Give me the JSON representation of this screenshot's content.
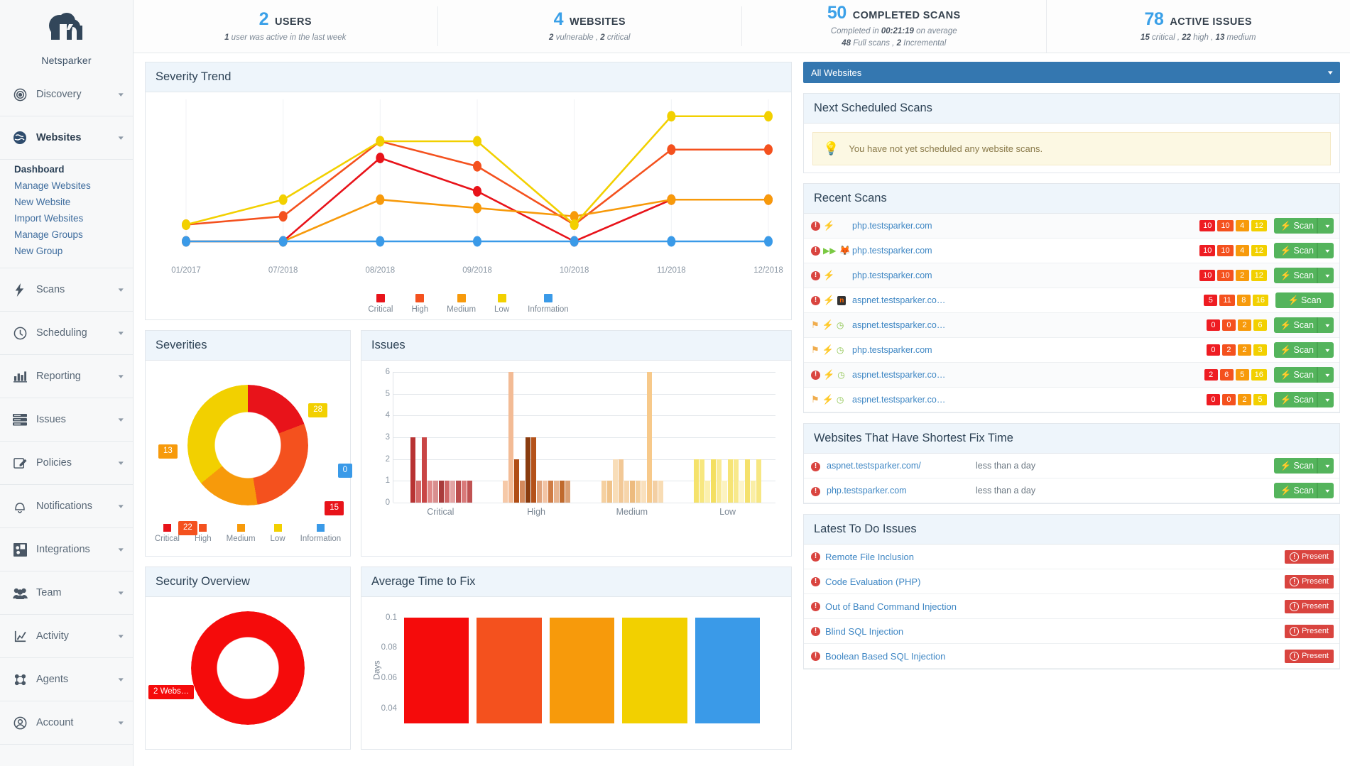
{
  "brand": {
    "name": "Netsparker"
  },
  "sidebar": {
    "items": [
      {
        "label": "Discovery",
        "icon": "target-icon",
        "active": false
      },
      {
        "label": "Websites",
        "icon": "globe-icon",
        "active": true
      },
      {
        "label": "Scans",
        "icon": "bolt-icon",
        "active": false
      },
      {
        "label": "Scheduling",
        "icon": "clock-icon",
        "active": false
      },
      {
        "label": "Reporting",
        "icon": "bar-chart-icon",
        "active": false
      },
      {
        "label": "Issues",
        "icon": "list-icon",
        "active": false
      },
      {
        "label": "Policies",
        "icon": "pencil-note-icon",
        "active": false
      },
      {
        "label": "Notifications",
        "icon": "bell-icon",
        "active": false
      },
      {
        "label": "Integrations",
        "icon": "puzzle-icon",
        "active": false
      },
      {
        "label": "Team",
        "icon": "people-icon",
        "active": false
      },
      {
        "label": "Activity",
        "icon": "activity-icon",
        "active": false
      },
      {
        "label": "Agents",
        "icon": "agents-icon",
        "active": false
      },
      {
        "label": "Account",
        "icon": "account-icon",
        "active": false
      }
    ],
    "websites_subnav": [
      {
        "label": "Dashboard",
        "current": true
      },
      {
        "label": "Manage Websites",
        "current": false
      },
      {
        "label": "New Website",
        "current": false
      },
      {
        "label": "Import Websites",
        "current": false
      },
      {
        "label": "Manage Groups",
        "current": false
      },
      {
        "label": "New Group",
        "current": false
      }
    ]
  },
  "stats": [
    {
      "num": "2",
      "cap": "USERS",
      "sub1_pre": "1",
      "sub1_post": " user was active in the last week",
      "sub2": ""
    },
    {
      "num": "4",
      "cap": "WEBSITES",
      "sub1_pre": "2",
      "sub1_post": " vulnerable , ",
      "sub1_b2": "2",
      "sub1_post2": " critical",
      "sub2": ""
    },
    {
      "num": "50",
      "cap": "COMPLETED SCANS",
      "sub1_pre": "Completed in ",
      "sub1_b": "00:21:19",
      "sub1_post": " on average",
      "sub2_b": "48",
      "sub2_mid": " Full scans , ",
      "sub2_b2": "2",
      "sub2_post": " Incremental"
    },
    {
      "num": "78",
      "cap": "ACTIVE ISSUES",
      "sub1_b": "15",
      "sub1_mid": " critical , ",
      "sub1_b2": "22",
      "sub1_mid2": " high , ",
      "sub1_b3": "13",
      "sub1_post": " medium"
    }
  ],
  "panels": {
    "severity_trend": "Severity Trend",
    "severities": "Severities",
    "issues": "Issues",
    "security_overview": "Security Overview",
    "average_time_to_fix": "Average Time to Fix"
  },
  "right": {
    "website_select": "All Websites",
    "next_scheduled_title": "Next Scheduled Scans",
    "next_scheduled_note": "You have not yet scheduled any website scans.",
    "recent_scans_title": "Recent Scans",
    "shortest_fix_title": "Websites That Have Shortest Fix Time",
    "todo_title": "Latest To Do Issues",
    "scan_label": "Scan",
    "present_label": "Present",
    "recent_scans": [
      {
        "icons": [
          "error",
          "bolt"
        ],
        "host": "php.testsparker.com",
        "badges": [
          "10",
          "10",
          "4",
          "12"
        ],
        "dropdown": true
      },
      {
        "icons": [
          "error",
          "forward",
          "fox"
        ],
        "host": "php.testsparker.com",
        "badges": [
          "10",
          "10",
          "4",
          "12"
        ],
        "dropdown": true
      },
      {
        "icons": [
          "error",
          "bolt"
        ],
        "host": "php.testsparker.com",
        "badges": [
          "10",
          "10",
          "2",
          "12"
        ],
        "dropdown": true
      },
      {
        "icons": [
          "error",
          "bolt",
          "n"
        ],
        "host": "aspnet.testsparker.co…",
        "badges": [
          "5",
          "11",
          "8",
          "16"
        ],
        "dropdown": false
      },
      {
        "icons": [
          "flag",
          "bolt",
          "clock"
        ],
        "host": "aspnet.testsparker.co…",
        "badges": [
          "0",
          "0",
          "2",
          "6"
        ],
        "dropdown": true
      },
      {
        "icons": [
          "flag",
          "bolt",
          "clock"
        ],
        "host": "php.testsparker.com",
        "badges": [
          "0",
          "2",
          "2",
          "3"
        ],
        "dropdown": true
      },
      {
        "icons": [
          "error",
          "bolt",
          "clock"
        ],
        "host": "aspnet.testsparker.co…",
        "badges": [
          "2",
          "6",
          "5",
          "16"
        ],
        "dropdown": true
      },
      {
        "icons": [
          "flag",
          "bolt",
          "clock"
        ],
        "host": "aspnet.testsparker.co…",
        "badges": [
          "0",
          "0",
          "2",
          "5"
        ],
        "dropdown": true
      }
    ],
    "shortest_fix": [
      {
        "host": "aspnet.testsparker.com/",
        "time": "less than a day"
      },
      {
        "host": "php.testsparker.com",
        "time": "less than a day"
      }
    ],
    "todo_issues": [
      "Remote File Inclusion",
      "Code Evaluation (PHP)",
      "Out of Band Command Injection",
      "Blind SQL Injection",
      "Boolean Based SQL Injection"
    ]
  },
  "colors": {
    "critical": "#e8131a",
    "high": "#f4511e",
    "medium": "#f79a0b",
    "low": "#f2d000",
    "information": "#3a9ae8",
    "accent_blue": "#3aa0e8",
    "green": "#54b45c",
    "present_red": "#d9443f",
    "header_bg": "#eef5fb"
  },
  "chart_data": [
    {
      "type": "line",
      "name": "severity-trend",
      "title": "Severity Trend",
      "x": [
        "01/2017",
        "07/2018",
        "08/2018",
        "09/2018",
        "10/2018",
        "11/2018",
        "12/2018"
      ],
      "xlabel": "",
      "ylabel": "",
      "grid": true,
      "legend": "bottom",
      "legend_entries": [
        "Critical",
        "High",
        "Medium",
        "Low",
        "Information"
      ],
      "series": [
        {
          "name": "Critical",
          "color": "#e8131a",
          "values": [
            0,
            0,
            10,
            6,
            0,
            5,
            5
          ]
        },
        {
          "name": "High",
          "color": "#f4511e",
          "values": [
            2,
            3,
            12,
            9,
            2,
            11,
            11
          ]
        },
        {
          "name": "Medium",
          "color": "#f79a0b",
          "values": [
            0,
            0,
            5,
            4,
            3,
            5,
            5
          ]
        },
        {
          "name": "Low",
          "color": "#f2d000",
          "values": [
            2,
            5,
            12,
            12,
            2,
            15,
            15
          ]
        },
        {
          "name": "Information",
          "color": "#3a9ae8",
          "values": [
            0,
            0,
            0,
            0,
            0,
            0,
            0
          ]
        }
      ]
    },
    {
      "type": "pie",
      "name": "severities-donut",
      "title": "Severities",
      "labels": [
        "Critical",
        "High",
        "Medium",
        "Low",
        "Information"
      ],
      "values": [
        15,
        22,
        13,
        28,
        0
      ],
      "colors": [
        "#e8131a",
        "#f4511e",
        "#f79a0b",
        "#f2d000",
        "#3a9ae8"
      ],
      "data_labels": [
        "15",
        "22",
        "13",
        "28",
        "0"
      ],
      "legend_entries": [
        "Critical",
        "High",
        "Medium",
        "Low",
        "Information"
      ]
    },
    {
      "type": "bar",
      "name": "issues-bars",
      "title": "Issues",
      "categories": [
        "Critical",
        "High",
        "Medium",
        "Low"
      ],
      "ylim": [
        0,
        6
      ],
      "yticks": [
        0,
        1,
        2,
        3,
        4,
        5,
        6
      ],
      "grid": true,
      "groups": [
        {
          "category": "Critical",
          "values": [
            3,
            1,
            3,
            1,
            1,
            1,
            1,
            1,
            1,
            1,
            1
          ]
        },
        {
          "category": "High",
          "values": [
            1,
            6,
            2,
            1,
            3,
            3,
            1,
            1,
            1,
            1,
            1,
            1
          ]
        },
        {
          "category": "Medium",
          "values": [
            1,
            1,
            2,
            2,
            1,
            1,
            1,
            1,
            6,
            1,
            1
          ]
        },
        {
          "category": "Low",
          "values": [
            2,
            2,
            1,
            2,
            2,
            1,
            2,
            2,
            1,
            2,
            1,
            2
          ]
        }
      ]
    },
    {
      "type": "bar",
      "name": "average-time-to-fix",
      "title": "Average Time to Fix",
      "ylabel": "Days",
      "yticks": [
        "0.1",
        "0.08",
        "0.06",
        "0.04"
      ],
      "ylim": [
        0.03,
        0.105
      ],
      "categories": [
        "",
        "",
        "",
        "",
        ""
      ],
      "values": [
        0.1,
        0.1,
        0.1,
        0.1,
        0.1
      ],
      "colors": [
        "#f50b0b",
        "#f4511e",
        "#f79a0b",
        "#f2d000",
        "#3a9ae8"
      ]
    },
    {
      "type": "pie",
      "name": "security-overview-donut",
      "title": "Security Overview",
      "labels": [
        "Critical"
      ],
      "values": [
        100
      ],
      "colors": [
        "#f50b0b"
      ],
      "data_labels": [
        "2 Webs…"
      ]
    }
  ]
}
